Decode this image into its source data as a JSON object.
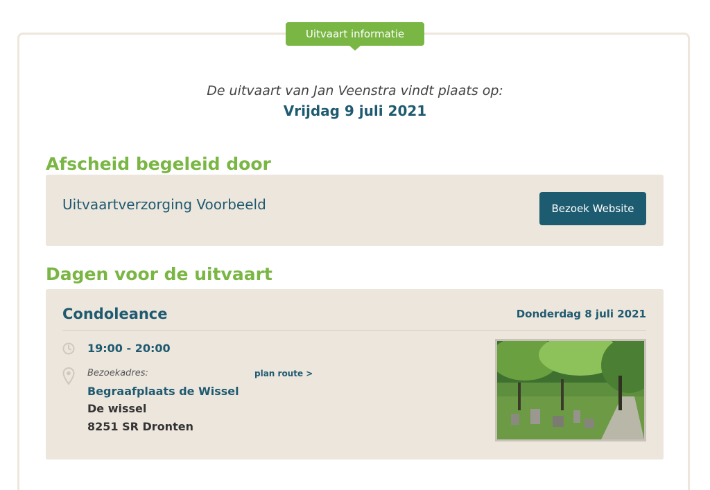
{
  "header": {
    "badge_label": "Uitvaart informatie"
  },
  "intro": {
    "text": "De uitvaart van Jan Veenstra vindt plaats op:",
    "date": "Vrijdag 9 juli 2021"
  },
  "guided": {
    "heading": "Afscheid begeleid door",
    "organization": "Uitvaartverzorging Voorbeeld",
    "button_label": "Bezoek Website"
  },
  "days": {
    "heading": "Dagen voor de uitvaart",
    "event": {
      "title": "Condoleance",
      "date": "Donderdag 8 juli 2021",
      "time": "19:00 - 20:00",
      "address_label": "Bezoekadres:",
      "route_label": "plan route >",
      "location_name": "Begraafplaats de Wissel",
      "street": "De wissel",
      "city": "8251 SR Dronten",
      "icons": [
        "clock-icon",
        "location-pin-icon"
      ]
    }
  },
  "colors": {
    "green": "#7ab644",
    "teal": "#1e5a70",
    "panel": "#ede6dd"
  }
}
